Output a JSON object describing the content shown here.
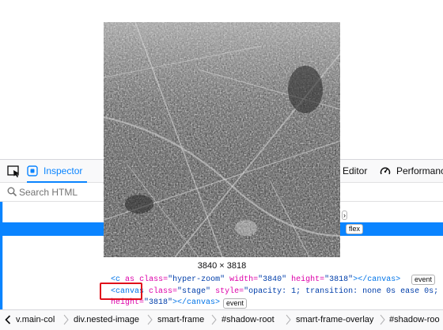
{
  "toolbar": {
    "inspector_label": "Inspector",
    "style_editor_label": "Editor",
    "performance_label": "Performance"
  },
  "search": {
    "placeholder": "Search HTML",
    "value": ""
  },
  "overlay": {
    "dimensions_label": "3840 × 3818"
  },
  "markup": {
    "line1": {
      "tag_open": "<c",
      "partial_attr": "as",
      "class_attr": "class=",
      "class_val": "\"hyper-zoom\"",
      "width_attr": "width=",
      "width_val": "\"3840\"",
      "height_attr": "height=",
      "height_val": "\"3818\"",
      "tag_close": "></canvas>",
      "badge": "event"
    },
    "line2": {
      "tag_open": "<canvas",
      "class_attr": "class=",
      "class_val": "\"stage\"",
      "style_attr": "style=",
      "style_val": "\"opacity: 1; transition: none 0s ease 0s;"
    },
    "line3": {
      "height_attr": "height=",
      "height_val": "\"3818\"",
      "tag_close": "></canvas>",
      "badge": "event"
    },
    "flex_badge": "flex"
  },
  "breadcrumbs": [
    "v.main-col",
    "div.nested-image",
    "smart-frame",
    "#shadow-root",
    "smart-frame-overlay",
    "#shadow-roo"
  ],
  "colors": {
    "accent": "#0a84ff",
    "highlight": "#e0101a"
  }
}
